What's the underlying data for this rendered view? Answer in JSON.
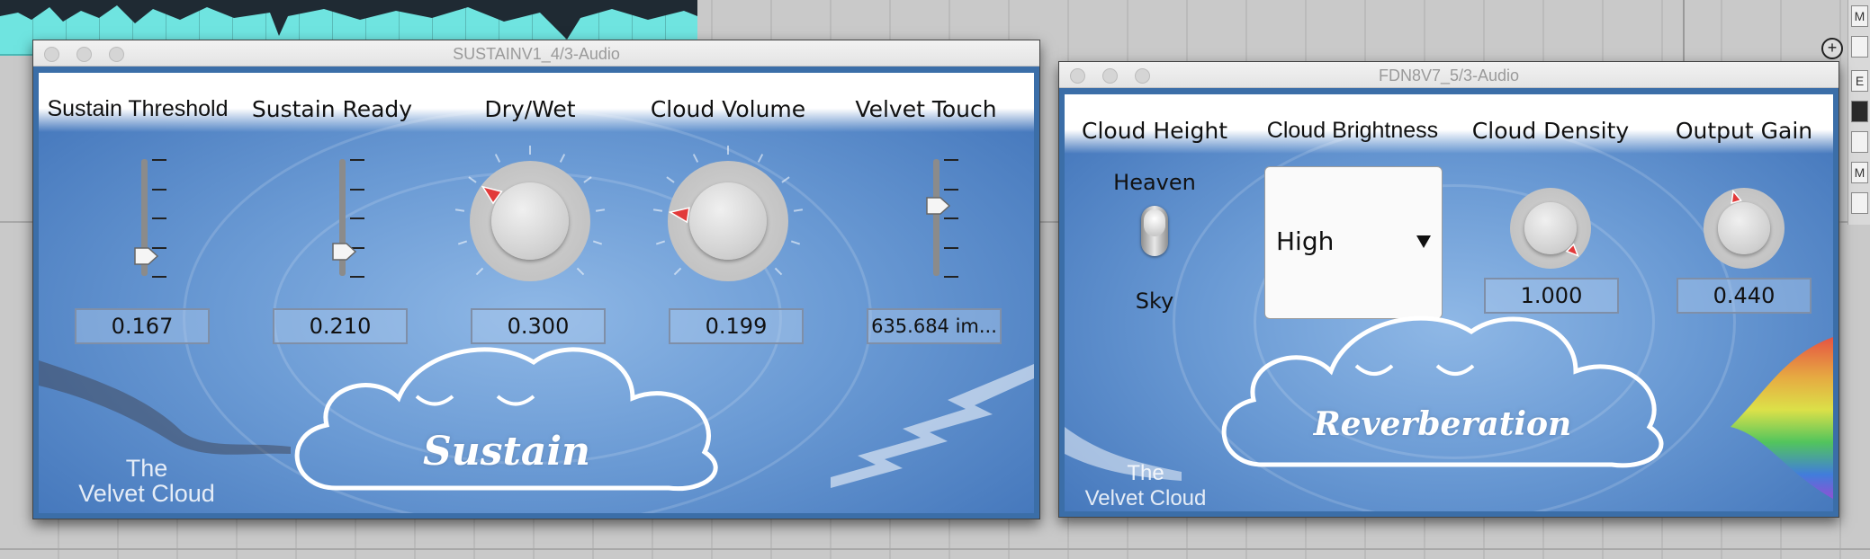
{
  "daw": {
    "plus_button": "+",
    "right_buttons": [
      "M",
      "",
      "E",
      "",
      "",
      "",
      "M",
      ""
    ]
  },
  "sustain_window": {
    "title": "SUSTAINV1_4/3-Audio",
    "params": [
      {
        "label": "Sustain Threshold",
        "value": "0.167",
        "control": "slider",
        "level": 0.167
      },
      {
        "label": "Sustain Ready",
        "value": "0.210",
        "control": "slider",
        "level": 0.21
      },
      {
        "label": "Dry/Wet",
        "value": "0.300",
        "control": "knob",
        "level": 0.3
      },
      {
        "label": "Cloud Volume",
        "value": "0.199",
        "control": "knob",
        "level": 0.199
      },
      {
        "label": "Velvet Touch",
        "value": "635.684 im...",
        "control": "slider",
        "level": 0.6
      }
    ],
    "brand": [
      "The",
      "Velvet Cloud"
    ],
    "cloud_text": "Sustain"
  },
  "reverb_window": {
    "title": "FDN8V7_5/3-Audio",
    "params": [
      {
        "label": "Cloud Height",
        "control": "toggle",
        "top_label": "Heaven",
        "bottom_label": "Sky",
        "state": "Sky"
      },
      {
        "label": "Cloud Brightness",
        "control": "dropdown",
        "value": "High"
      },
      {
        "label": "Cloud Density",
        "value": "1.000",
        "control": "knob",
        "level": 1.0
      },
      {
        "label": "Output Gain",
        "value": "0.440",
        "control": "knob",
        "level": 0.44
      }
    ],
    "brand": [
      "The",
      "Velvet Cloud"
    ],
    "cloud_text": "Reverberation"
  },
  "colors": {
    "panel_blue": "#6a9ad4",
    "knob_indicator": "#e23a3a",
    "clip_cyan": "#6fe4e0"
  }
}
